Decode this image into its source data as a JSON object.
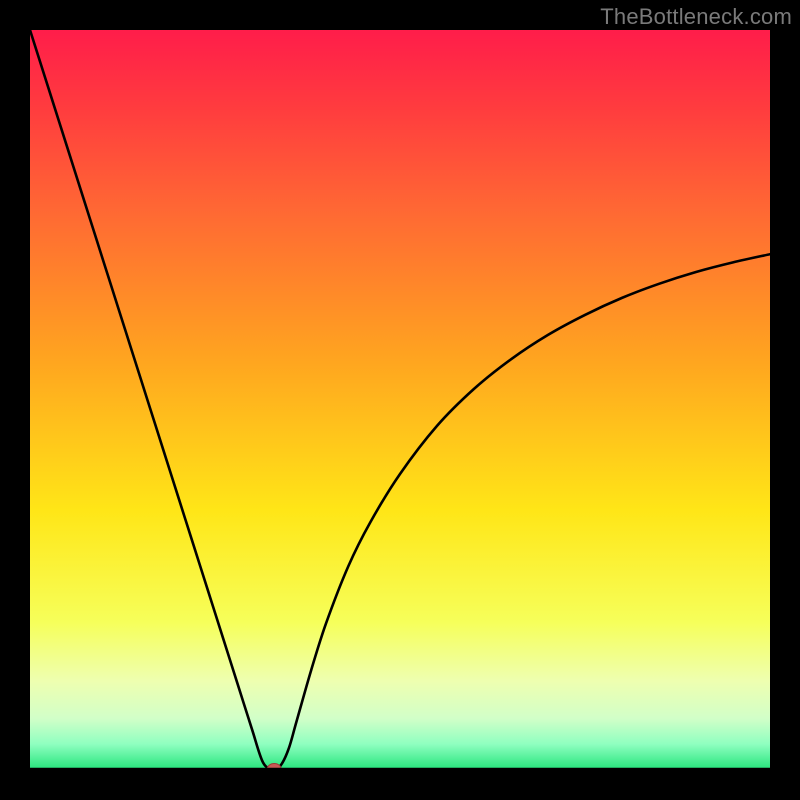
{
  "watermark": "TheBottleneck.com",
  "colors": {
    "frame": "#000000",
    "curve": "#000000",
    "marker_fill": "#c85a56",
    "marker_stroke": "#9e3c38",
    "gradient_stops": [
      {
        "offset": 0.0,
        "color": "#ff1d4a"
      },
      {
        "offset": 0.1,
        "color": "#ff3a3f"
      },
      {
        "offset": 0.25,
        "color": "#ff6a33"
      },
      {
        "offset": 0.45,
        "color": "#ffa61f"
      },
      {
        "offset": 0.65,
        "color": "#ffe617"
      },
      {
        "offset": 0.8,
        "color": "#f6ff5a"
      },
      {
        "offset": 0.88,
        "color": "#eeffb0"
      },
      {
        "offset": 0.93,
        "color": "#d2ffc8"
      },
      {
        "offset": 0.965,
        "color": "#8fffc0"
      },
      {
        "offset": 1.0,
        "color": "#23e47a"
      }
    ]
  },
  "chart_data": {
    "type": "line",
    "title": "",
    "xlabel": "",
    "ylabel": "",
    "xlim": [
      0,
      100
    ],
    "ylim": [
      0,
      100
    ],
    "legend": false,
    "grid": false,
    "series": [
      {
        "name": "bottleneck-curve",
        "x": [
          0,
          2,
          4,
          6,
          8,
          10,
          12,
          14,
          16,
          18,
          20,
          22,
          24,
          26,
          28,
          30,
          31.5,
          33,
          34,
          35,
          36,
          38,
          40,
          43,
          46,
          50,
          55,
          60,
          65,
          70,
          75,
          80,
          85,
          90,
          95,
          100
        ],
        "y": [
          100,
          93.7,
          87.4,
          81.1,
          74.8,
          68.5,
          62.2,
          55.9,
          49.6,
          43.3,
          37.0,
          30.7,
          24.4,
          18.1,
          11.8,
          5.5,
          1.0,
          0.0,
          0.8,
          3.0,
          6.5,
          13.5,
          19.8,
          27.5,
          33.5,
          40.0,
          46.5,
          51.5,
          55.5,
          58.8,
          61.5,
          63.8,
          65.7,
          67.3,
          68.6,
          69.7
        ]
      }
    ],
    "marker": {
      "name": "optimal-point",
      "x": 33,
      "y": 0
    }
  }
}
